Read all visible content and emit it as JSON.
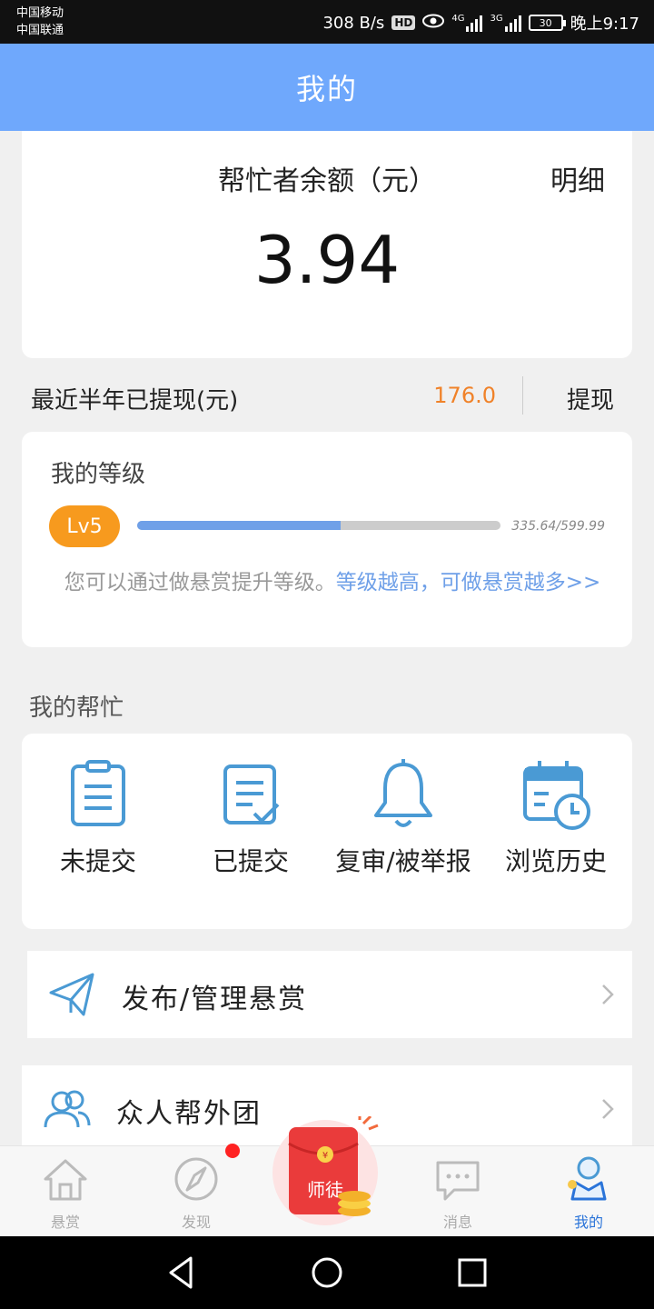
{
  "status_bar": {
    "carrier_1": "中国移动",
    "carrier_2": "中国联通",
    "network_speed": "308 B/s",
    "hd": "HD",
    "signal_1": "4G",
    "signal_2": "3G",
    "battery": "30",
    "time": "晚上9:17"
  },
  "header": {
    "title": "我的"
  },
  "balance": {
    "label": "帮忙者余额（元）",
    "detail_label": "明细",
    "value": "3.94"
  },
  "withdraw": {
    "label": "最近半年已提现(元)",
    "amount": "176.0",
    "button_label": "提现"
  },
  "level": {
    "title": "我的等级",
    "badge": "Lv5",
    "points": "335.64/599.99",
    "progress": 0.5594,
    "tip": "您可以通过做悬赏提升等级。",
    "tip_link": "等级越高，可做悬赏越多>>"
  },
  "my_help": {
    "title": "我的帮忙",
    "items": [
      {
        "label": "未提交",
        "icon": "clipboard-icon"
      },
      {
        "label": "已提交",
        "icon": "document-check-icon"
      },
      {
        "label": "复审/被举报",
        "icon": "bell-icon"
      },
      {
        "label": "浏览历史",
        "icon": "calendar-clock-icon"
      }
    ]
  },
  "rows": [
    {
      "label": "发布/管理悬赏",
      "icon": "paper-plane-icon"
    },
    {
      "label": "众人帮外团",
      "icon": "group-icon"
    }
  ],
  "tabs": [
    {
      "label": "悬赏",
      "icon": "home-icon"
    },
    {
      "label": "发现",
      "icon": "compass-icon"
    },
    {
      "label": "消息",
      "icon": "chat-icon"
    },
    {
      "label": "我的",
      "icon": "profile-icon"
    }
  ],
  "promo": {
    "label": "师徒",
    "icon": "red-envelope-icon"
  },
  "colors": {
    "header": "#6fa8fc",
    "accent_blue": "#6fa0e8",
    "orange": "#f79a1e",
    "amount_orange": "#f08229",
    "icon_blue": "#4a9ad4",
    "active_tab": "#2b74d9"
  }
}
